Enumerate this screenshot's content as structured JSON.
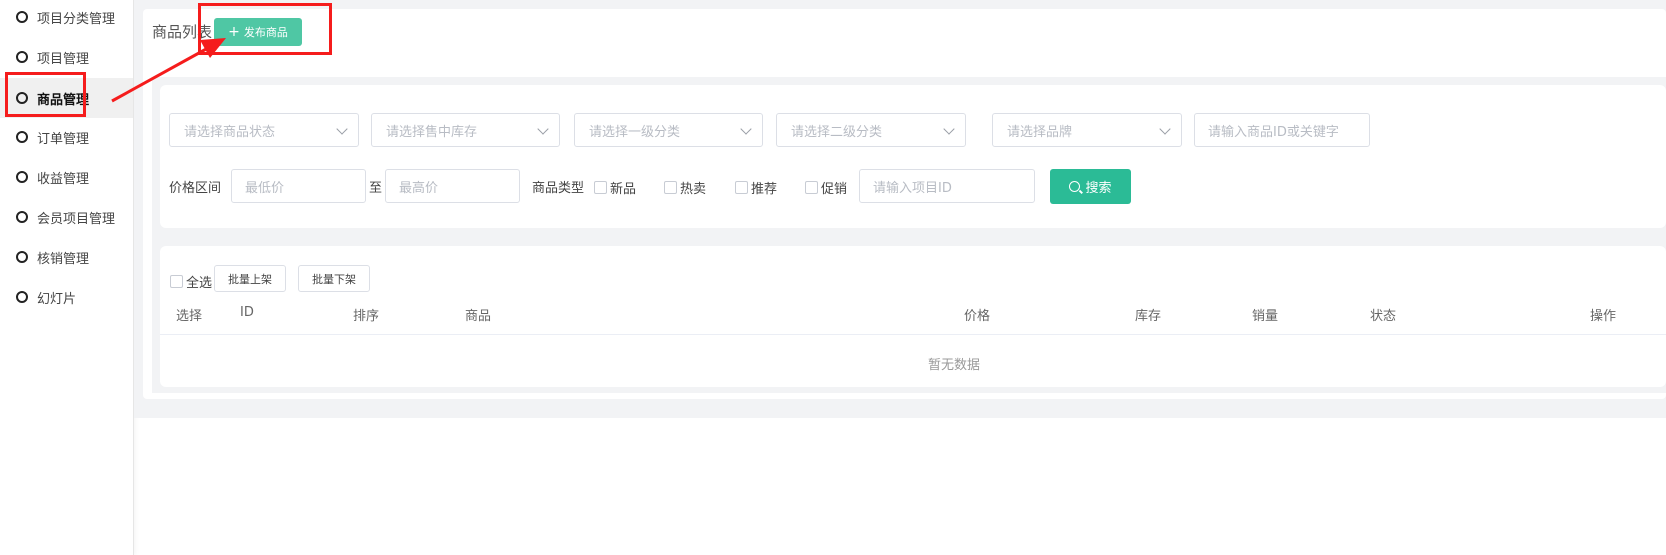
{
  "sidebar": {
    "items": [
      {
        "label": "项目分类管理",
        "active": false
      },
      {
        "label": "项目管理",
        "active": false
      },
      {
        "label": "商品管理",
        "active": true
      },
      {
        "label": "订单管理",
        "active": false
      },
      {
        "label": "收益管理",
        "active": false
      },
      {
        "label": "会员项目管理",
        "active": false
      },
      {
        "label": "核销管理",
        "active": false
      },
      {
        "label": "幻灯片",
        "active": false
      }
    ]
  },
  "header": {
    "title": "商品列表",
    "publish_button": "发布商品",
    "publish_icon": "plus-icon"
  },
  "filters": {
    "selects": [
      {
        "placeholder": "请选择商品状态"
      },
      {
        "placeholder": "请选择售中库存"
      },
      {
        "placeholder": "请选择一级分类"
      },
      {
        "placeholder": "请选择二级分类"
      },
      {
        "placeholder": "请选择品牌"
      }
    ],
    "keyword_placeholder": "请输入商品ID或关键字",
    "price_label": "价格区间",
    "min_price_placeholder": "最低价",
    "to_label": "至",
    "max_price_placeholder": "最高价",
    "type_label": "商品类型",
    "type_options": [
      "新品",
      "热卖",
      "推荐",
      "促销"
    ],
    "project_id_placeholder": "请输入项目ID",
    "search_button": "搜索",
    "search_icon": "search-icon"
  },
  "table": {
    "select_all": "全选",
    "batch_on": "批量上架",
    "batch_off": "批量下架",
    "columns": [
      "选择",
      "ID",
      "排序",
      "商品",
      "价格",
      "库存",
      "销量",
      "状态",
      "操作"
    ],
    "empty_text": "暂无数据"
  },
  "colors": {
    "primary": "#2bbb96",
    "publish": "#4fc7a4",
    "annotation": "#f51c1c"
  }
}
